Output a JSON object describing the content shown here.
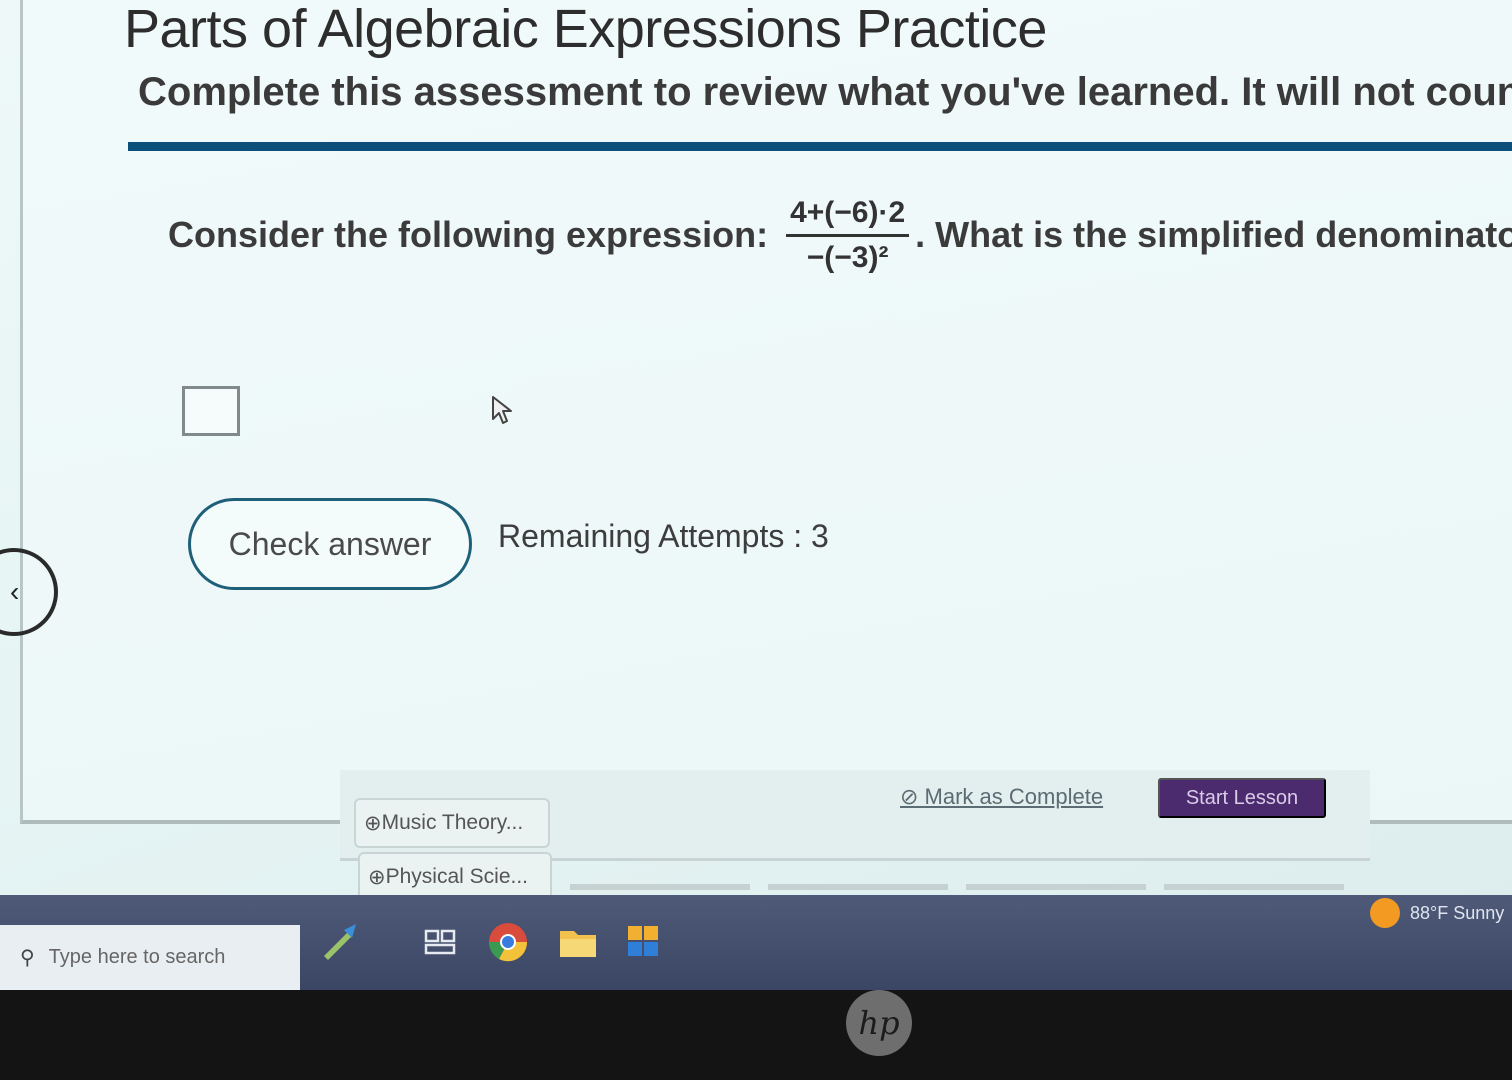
{
  "header": {
    "title": "Parts of Algebraic Expressions Practice",
    "subtitle": "Complete this assessment to review what you've learned. It will not count tow"
  },
  "question": {
    "prefix": "Consider the following expression:",
    "numerator": "4+(−6)·2",
    "denominator": "−(−3)²",
    "suffix": ". What is the simplified denominator? ("
  },
  "answer": {
    "value": ""
  },
  "check_answer_label": "Check answer",
  "remaining_attempts": "Remaining Attempts : 3",
  "lesson_bar": {
    "mark_complete": "Mark as Complete",
    "start_lesson": "Start Lesson",
    "tabs": [
      "Music Theory...",
      "Physical Scie..."
    ]
  },
  "taskbar": {
    "search_placeholder": "Type here to search",
    "weather": "88°F Sunny"
  },
  "bezel_logo": "hp",
  "colors": {
    "accent_rule": "#0c4f7a",
    "button_border": "#1e5f7a",
    "start_lesson_bg": "#4b2a6e",
    "taskbar": "#3a4663",
    "weather_sun": "#f29a22"
  }
}
